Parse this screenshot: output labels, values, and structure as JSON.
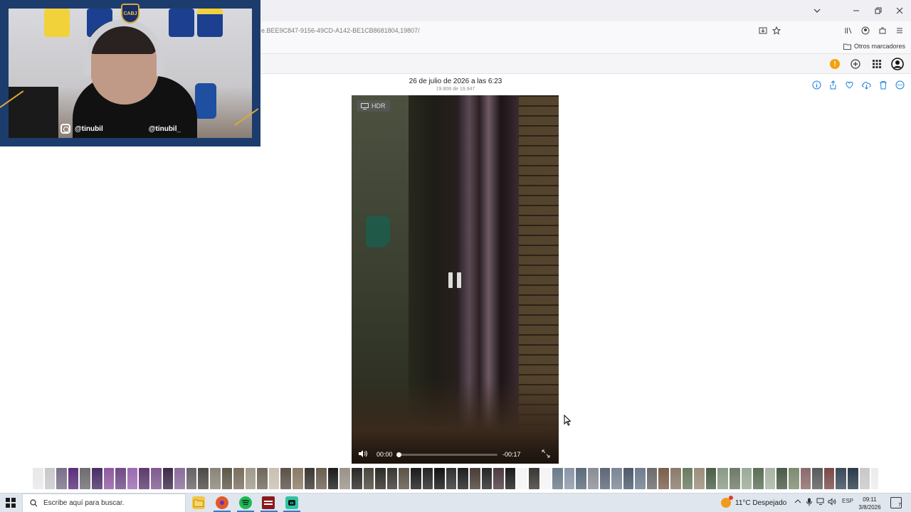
{
  "browser": {
    "url": "e.BEE9C847-9156-49CD-A142-BE1CB8681804,19807/",
    "bookmarks_other": "Otros marcadores",
    "icons": [
      "download-icon",
      "star-icon",
      "library-icon",
      "account-icon",
      "extensions-icon",
      "menu-icon"
    ]
  },
  "app_header": {
    "alert_badge": "!",
    "icons": [
      "alert-icon",
      "add-icon",
      "apps-grid-icon",
      "profile-icon"
    ]
  },
  "photo": {
    "date_title": "26 de julio de 2026 a las 6:23",
    "counter": "19.808 de 19.947",
    "actions": [
      "info-icon",
      "share-icon",
      "heart-icon",
      "download-cloud-icon",
      "trash-icon",
      "more-icon"
    ]
  },
  "video": {
    "badge": "HDR",
    "current_time": "00:00",
    "remaining_time": "-00:17",
    "progress": 0.01
  },
  "webcam": {
    "instagram_handle_left": "@tinubil",
    "instagram_handle_right": "@tinubil_",
    "crest": "CABJ"
  },
  "taskbar": {
    "search_placeholder": "Escribe aquí para buscar.",
    "weather": "11°C  Despejado",
    "language": "ESP",
    "time": "09:11",
    "date": "3/8/2026",
    "notif_count": "7",
    "apps": [
      "file-explorer-icon",
      "firefox-icon",
      "spotify-icon",
      "voicemeeter-icon",
      "streamlabs-icon"
    ]
  },
  "thumbnail_colors": [
    "#e8e8e8",
    "#c8c8cc",
    "#7a6f88",
    "#5a2e7a",
    "#6d6b70",
    "#4a2d66",
    "#8e5aa0",
    "#6f4a85",
    "#9a6ab0",
    "#5c3a6e",
    "#7f5a90",
    "#3d2a48",
    "#8a6c9a",
    "#676266",
    "#4c4a44",
    "#8a8478",
    "#5c5848",
    "#7a6e5c",
    "#a09a8c",
    "#6e685a",
    "#c8c0b0",
    "#5a5046",
    "#8a7a66",
    "#3a3630",
    "#6a5e50",
    "#1c1c1c",
    "#9a9288",
    "#2a2826",
    "#4a463c",
    "#2c2a26",
    "#3a3632",
    "#5c5246",
    "#1a1a1a",
    "#242424",
    "#121212",
    "#303030",
    "#1e1e1e",
    "#4a3c36",
    "#262626",
    "#4c3a40",
    "#1a1a1a",
    "#f4f4f4",
    "#3a3632",
    "#f4f4f4",
    "#6a7a8a",
    "#8a96a8",
    "#5a6a7a",
    "#8a8c96",
    "#5c6678",
    "#7a8694",
    "#4c5a6a",
    "#6e7c8c",
    "#6a6a6a",
    "#7a5e4a",
    "#8a7a6a",
    "#6a7a60",
    "#9a8e7a",
    "#4a5e48",
    "#8a9a86",
    "#6e7a68",
    "#9aaa98",
    "#5a6e56",
    "#a8b4a4",
    "#4a5a46",
    "#7e8a70",
    "#8a6a6a",
    "#5a5a5a",
    "#7a4a4a",
    "#3a4a5a",
    "#2a3a4a",
    "#c8c8c8",
    "#ececec",
    "#5a5046",
    "#4a463e",
    "#7a7268",
    "#6e645a",
    "#8a8a8a",
    "#5a6a7a",
    "#7a8a9a",
    "#4a5a6a",
    "#6a5a4a",
    "#3a4a5c",
    "#5a6a80",
    "#2a2a2a",
    "#6a7a8a",
    "#1a1a1a",
    "#c8c8c8",
    "#4a4a52",
    "#2a2a30",
    "#6a6a72",
    "#b0b0b4",
    "#d8d8d8",
    "#ececec"
  ]
}
